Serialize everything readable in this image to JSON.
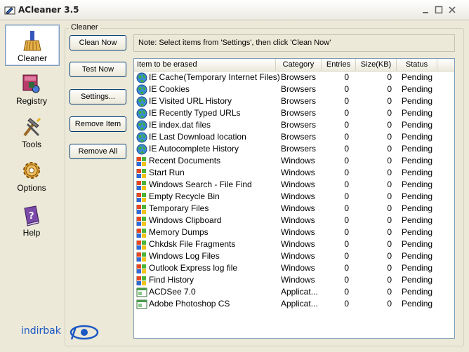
{
  "window": {
    "title": "ACleaner 3.5"
  },
  "sidebar": {
    "items": [
      {
        "label": "Cleaner",
        "icon": "broom-icon"
      },
      {
        "label": "Registry",
        "icon": "registry-icon"
      },
      {
        "label": "Tools",
        "icon": "hammer-icon"
      },
      {
        "label": "Options",
        "icon": "gear-icon"
      },
      {
        "label": "Help",
        "icon": "help-book-icon"
      }
    ]
  },
  "brand": {
    "name": "indirbak"
  },
  "group": {
    "title": "Cleaner"
  },
  "buttons": {
    "clean_now": "Clean Now",
    "test_now": "Test Now",
    "settings": "Settings...",
    "remove_item": "Remove Item",
    "remove_all": "Remove All"
  },
  "note": "Note: Select items from 'Settings', then click 'Clean Now'",
  "table": {
    "headers": [
      "Item to be erased",
      "Category",
      "Entries",
      "Size(KB)",
      "Status"
    ],
    "rows": [
      {
        "item": "IE Cache(Temporary Internet Files)",
        "category": "Browsers",
        "entries": "0",
        "size": "0",
        "status": "Pending",
        "icon": "globe-icon"
      },
      {
        "item": "IE Cookies",
        "category": "Browsers",
        "entries": "0",
        "size": "0",
        "status": "Pending",
        "icon": "globe-icon"
      },
      {
        "item": "IE Visited URL History",
        "category": "Browsers",
        "entries": "0",
        "size": "0",
        "status": "Pending",
        "icon": "globe-icon"
      },
      {
        "item": "IE Recently Typed URLs",
        "category": "Browsers",
        "entries": "0",
        "size": "0",
        "status": "Pending",
        "icon": "globe-icon"
      },
      {
        "item": "IE index.dat files",
        "category": "Browsers",
        "entries": "0",
        "size": "0",
        "status": "Pending",
        "icon": "globe-icon"
      },
      {
        "item": "IE Last Download location",
        "category": "Browsers",
        "entries": "0",
        "size": "0",
        "status": "Pending",
        "icon": "globe-icon"
      },
      {
        "item": "IE Autocomplete History",
        "category": "Browsers",
        "entries": "0",
        "size": "0",
        "status": "Pending",
        "icon": "globe-icon"
      },
      {
        "item": "Recent Documents",
        "category": "Windows",
        "entries": "0",
        "size": "0",
        "status": "Pending",
        "icon": "windows-flag-icon"
      },
      {
        "item": "Start Run",
        "category": "Windows",
        "entries": "0",
        "size": "0",
        "status": "Pending",
        "icon": "windows-flag-icon"
      },
      {
        "item": "Windows Search - File Find",
        "category": "Windows",
        "entries": "0",
        "size": "0",
        "status": "Pending",
        "icon": "windows-flag-icon"
      },
      {
        "item": "Empty Recycle Bin",
        "category": "Windows",
        "entries": "0",
        "size": "0",
        "status": "Pending",
        "icon": "windows-flag-icon"
      },
      {
        "item": "Temporary Files",
        "category": "Windows",
        "entries": "0",
        "size": "0",
        "status": "Pending",
        "icon": "windows-flag-icon"
      },
      {
        "item": "Windows Clipboard",
        "category": "Windows",
        "entries": "0",
        "size": "0",
        "status": "Pending",
        "icon": "windows-flag-icon"
      },
      {
        "item": "Memory Dumps",
        "category": "Windows",
        "entries": "0",
        "size": "0",
        "status": "Pending",
        "icon": "windows-flag-icon"
      },
      {
        "item": "Chkdsk File Fragments",
        "category": "Windows",
        "entries": "0",
        "size": "0",
        "status": "Pending",
        "icon": "windows-flag-icon"
      },
      {
        "item": "Windows Log Files",
        "category": "Windows",
        "entries": "0",
        "size": "0",
        "status": "Pending",
        "icon": "windows-flag-icon"
      },
      {
        "item": "Outlook Express log file",
        "category": "Windows",
        "entries": "0",
        "size": "0",
        "status": "Pending",
        "icon": "windows-flag-icon"
      },
      {
        "item": "Find History",
        "category": "Windows",
        "entries": "0",
        "size": "0",
        "status": "Pending",
        "icon": "windows-flag-icon"
      },
      {
        "item": "ACDSee 7.0",
        "category": "Applicat...",
        "entries": "0",
        "size": "0",
        "status": "Pending",
        "icon": "application-icon"
      },
      {
        "item": "Adobe Photoshop CS",
        "category": "Applicat...",
        "entries": "0",
        "size": "0",
        "status": "Pending",
        "icon": "application-icon"
      }
    ]
  }
}
